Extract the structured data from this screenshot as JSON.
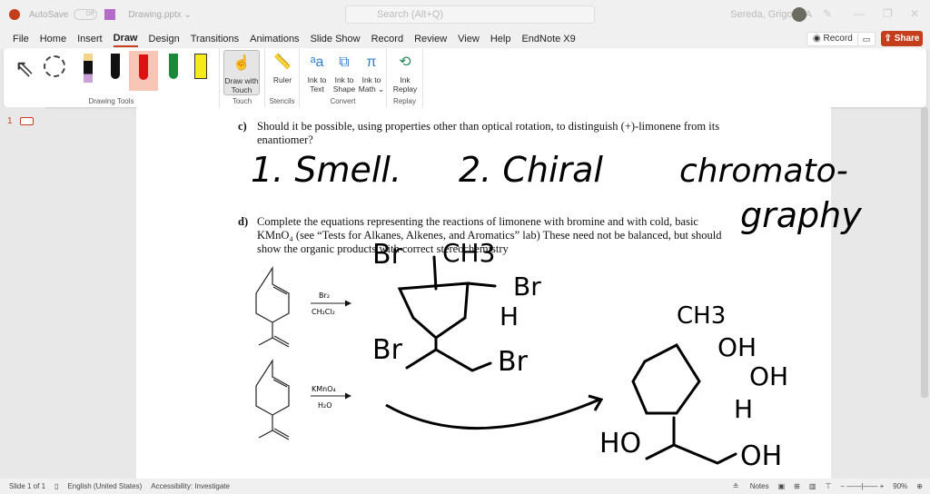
{
  "titlebar": {
    "autosave": "AutoSave",
    "toggle": "Off",
    "filename": "Drawing.pptx ⌄",
    "search": "Search (Alt+Q)",
    "user": "Sereda, Grigoriy A"
  },
  "menu": {
    "tabs": [
      "File",
      "Home",
      "Insert",
      "Draw",
      "Design",
      "Transitions",
      "Animations",
      "Slide Show",
      "Record",
      "Review",
      "View",
      "Help",
      "EndNote X9"
    ],
    "record": "Record",
    "share": "Share"
  },
  "ribbon": {
    "groups": {
      "drawing_tools": "Drawing Tools",
      "touch": "Touch",
      "stencils": "Stencils",
      "convert": "Convert",
      "replay": "Replay"
    },
    "buttons": {
      "draw_touch": "Draw with Touch",
      "ruler": "Ruler",
      "ink_text": "Ink to Text",
      "ink_shape": "Ink to Shape",
      "ink_math": "Ink to Math ⌄",
      "ink_replay": "Ink Replay"
    }
  },
  "thumbs": {
    "num": "1"
  },
  "slide": {
    "qc_label": "c)",
    "qc_text": "Should it be possible, using properties other than optical rotation, to distinguish (+)-limonene from its enantiomer?",
    "qd_label": "d)",
    "qd_text": "Complete the equations representing the reactions of limonene with bromine and with cold, basic KMnO₄ (see “Tests for Alkanes, Alkenes, and Aromatics” lab) These need not be balanced, but should show the organic products with correct stereochemistry",
    "r1_top": "Br₂",
    "r1_bottom": "CH₂Cl₂",
    "r2_top": "KMnO₄",
    "r2_bottom": "H₂O",
    "ink": {
      "answer1": "1. Smell.",
      "answer2": "2. Chiral",
      "answer3": "chromato-",
      "answer4": "graphy",
      "br_top": "Br",
      "ch3_top": "CH3",
      "br_right": "Br",
      "h_right": "H",
      "br_left": "Br",
      "br_bottom": "Br",
      "ch3_b": "CH3",
      "oh1": "OH",
      "oh2": "OH",
      "h_b": "H",
      "ho": "HO",
      "oh3": "OH"
    }
  },
  "status": {
    "slide": "Slide 1 of 1",
    "language": "English (United States)",
    "accessibility": "Accessibility: Investigate",
    "notes": "Notes",
    "zoom": "90%"
  }
}
